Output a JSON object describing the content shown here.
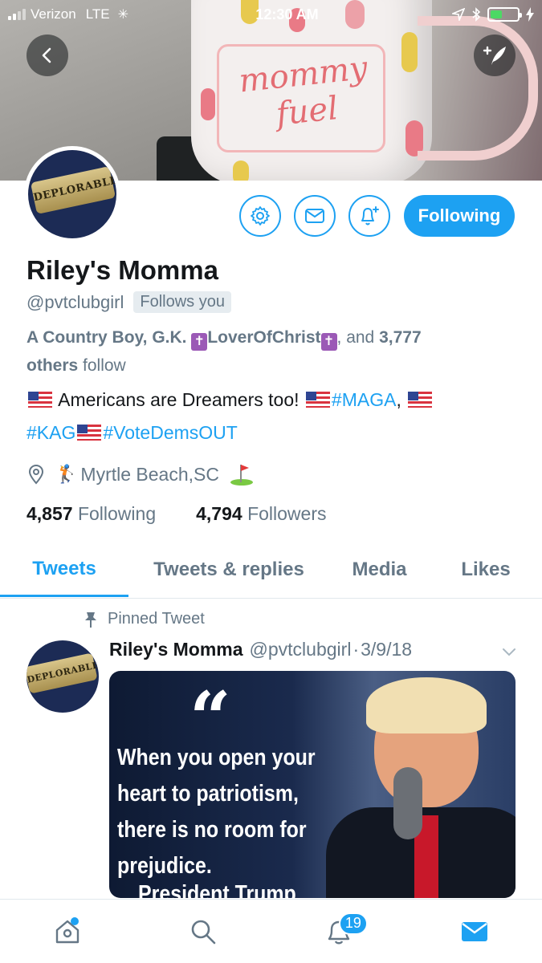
{
  "status_bar": {
    "carrier": "Verizon",
    "network": "LTE",
    "time": "12:30 AM"
  },
  "banner": {
    "mug_text": "mommy fuel"
  },
  "profile": {
    "name": "Riley's Momma",
    "handle": "@pvtclubgirl",
    "follows_you": "Follows you",
    "avatar_text": "DEPLORABLE",
    "followed_by": {
      "names_part1": "A Country Boy, G.K. ",
      "names_part2": "LoverOfChrist",
      "connector": ", and ",
      "others_count": "3,777",
      "others_label": "others",
      "suffix": " follow"
    },
    "bio": {
      "text1": " Americans are Dreamers too! ",
      "tag1": "#MAGA",
      "comma": ", ",
      "tag2": "#KAG",
      "tag3": "#VoteDemsOUT"
    },
    "location": "Myrtle Beach,SC",
    "following_count": "4,857",
    "following_label": "Following",
    "followers_count": "4,794",
    "followers_label": "Followers",
    "follow_button": "Following"
  },
  "tabs": [
    {
      "label": "Tweets",
      "active": true
    },
    {
      "label": "Tweets & replies",
      "active": false
    },
    {
      "label": "Media",
      "active": false
    },
    {
      "label": "Likes",
      "active": false
    }
  ],
  "pinned_tweet": {
    "pinned_label": "Pinned Tweet",
    "author": "Riley's Momma",
    "handle": "@pvtclubgirl",
    "separator": "·",
    "date": "3/9/18",
    "image_quote": "When you open your heart to patriotism, there is no room for prejudice.",
    "image_attribution": "President Trump"
  },
  "bottom_nav": {
    "notifications_badge": "19"
  },
  "colors": {
    "accent": "#1da1f2",
    "secondary_text": "#657786",
    "primary_text": "#14171a"
  },
  "icons": [
    "back-arrow-icon",
    "compose-tweet-icon",
    "gear-icon",
    "mail-icon",
    "bell-plus-icon",
    "location-pin-icon",
    "pin-icon",
    "chevron-down-icon",
    "home-icon",
    "search-icon",
    "bell-icon",
    "envelope-icon"
  ]
}
